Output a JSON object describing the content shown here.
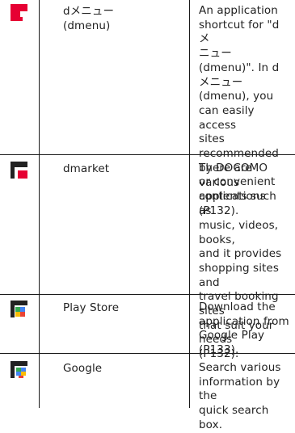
{
  "rows": [
    {
      "icon": "dmenu-icon",
      "name": "dメニュー\n(dmenu)",
      "description": "An application\nshortcut for \"dメ\nニュー (dmenu)\". In d\nメニュー (dmenu), you\ncan easily access\nsites recommended\nby DOCOMO\nor convenient\napplications (P132)."
    },
    {
      "icon": "dmarket-icon",
      "name": "dmarket",
      "description": "There are various\ncontents such as\nmusic, videos, books,\nand it provides\nshopping sites and\ntravel booking sites\nthat suit your needs\n(P132)."
    },
    {
      "icon": "play-store-icon",
      "name": "Play Store",
      "description": "Download the\napplication from\nGoogle Play (P133)."
    },
    {
      "icon": "google-icon",
      "name": "Google",
      "description": "Search various\ninformation by the\nquick search box."
    }
  ],
  "colors": {
    "docomo_red": "#e60033",
    "border": "#1a1a1a",
    "text": "#222222"
  }
}
